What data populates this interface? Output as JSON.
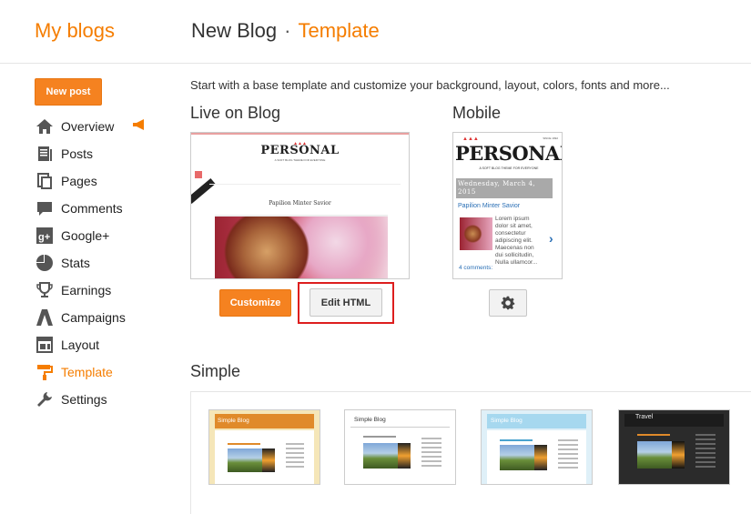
{
  "header": {
    "brand": "My blogs",
    "blog_name": "New Blog",
    "separator": "·",
    "section": "Template"
  },
  "sidebar": {
    "new_post": "New post",
    "items": [
      {
        "label": "Overview",
        "icon": "home-icon"
      },
      {
        "label": "Posts",
        "icon": "posts-icon"
      },
      {
        "label": "Pages",
        "icon": "pages-icon"
      },
      {
        "label": "Comments",
        "icon": "comments-icon"
      },
      {
        "label": "Google+",
        "icon": "google-plus-icon"
      },
      {
        "label": "Stats",
        "icon": "stats-icon"
      },
      {
        "label": "Earnings",
        "icon": "trophy-icon"
      },
      {
        "label": "Campaigns",
        "icon": "campaigns-icon"
      },
      {
        "label": "Layout",
        "icon": "layout-icon"
      },
      {
        "label": "Template",
        "icon": "paint-roller-icon",
        "active": true
      },
      {
        "label": "Settings",
        "icon": "wrench-icon"
      }
    ]
  },
  "main": {
    "intro": "Start with a base template and customize your background, layout, colors, fonts and more...",
    "live_title": "Live on Blog",
    "mobile_title": "Mobile",
    "customize": "Customize",
    "edit_html": "Edit HTML",
    "simple_title": "Simple"
  },
  "live_preview": {
    "logo": "PERSONAL",
    "tagline": "A SOFT BLOG THEME FOR EVERYONE",
    "post_title": "Papilion Minter Savior"
  },
  "mobile_preview": {
    "logo": "PERSONAL",
    "since": "SINCE 1992",
    "tagline": "A SOFT BLOG THEME FOR EVERYONE",
    "date": "Wednesday, March 4, 2015",
    "post_title": "Papilion Minter Savior",
    "excerpt": "Lorem ipsum dolor sit amet, consectetur adipiscing elit. Maecenas non dui sollicitudin, Nulla ullamcor...",
    "comments": "4 comments:"
  },
  "simple_templates": [
    {
      "title": "Simple Blog"
    },
    {
      "title": "Simple Blog"
    },
    {
      "title": "Simple Blog"
    },
    {
      "title": "Travel"
    }
  ],
  "colors": {
    "accent": "#f57d00",
    "highlight": "#dd1e1e"
  }
}
